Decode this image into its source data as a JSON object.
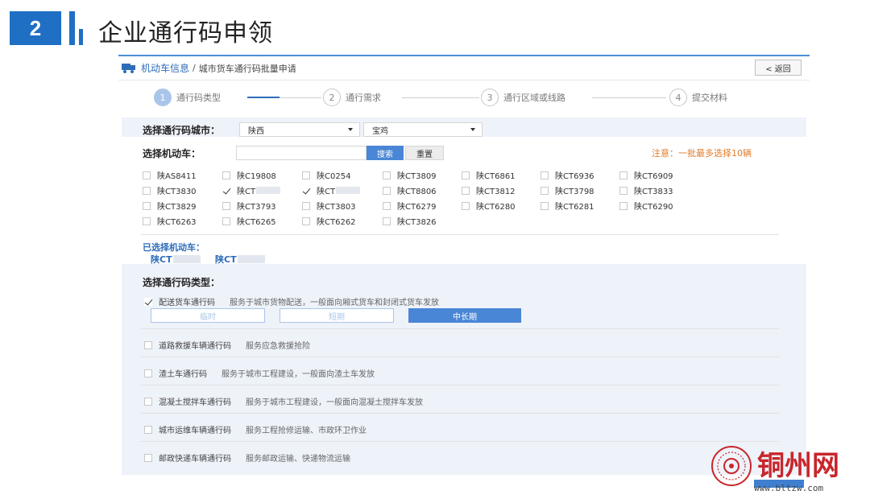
{
  "slide": {
    "number": "2",
    "title": "企业通行码申领"
  },
  "breadcrumb": {
    "root": "机动车信息",
    "separator": "/",
    "current": "城市货车通行码批量申请"
  },
  "back_button": "< 返回",
  "steps": [
    {
      "num": "1",
      "label": "通行码类型",
      "active": true
    },
    {
      "num": "2",
      "label": "通行需求",
      "active": false
    },
    {
      "num": "3",
      "label": "通行区域或线路",
      "active": false
    },
    {
      "num": "4",
      "label": "提交材料",
      "active": false
    }
  ],
  "city": {
    "label": "选择通行码城市：",
    "province": "陕西",
    "city": "宝鸡"
  },
  "vehicle": {
    "label": "选择机动车：",
    "search_value": "",
    "search_button": "搜索",
    "reset_button": "重置",
    "note": "注意：一批最多选择10辆"
  },
  "vehicles": [
    [
      "陕AS8411",
      "陕C19808",
      "陕C0254",
      "陕CT3809",
      "陕CT6861",
      "陕CT6936",
      "陕CT6909"
    ],
    [
      "陕CT3830",
      "陕CT",
      "陕CT",
      "陕CT8806",
      "陕CT3812",
      "陕CT3798",
      "陕CT3833"
    ],
    [
      "陕CT3829",
      "陕CT3793",
      "陕CT3803",
      "陕CT6279",
      "陕CT6280",
      "陕CT6281",
      "陕CT6290"
    ],
    [
      "陕CT6263",
      "陕CT6265",
      "陕CT6262",
      "陕CT3826"
    ]
  ],
  "selected": {
    "label": "已选择机动车：",
    "items": [
      "陕CT",
      "陕CT"
    ]
  },
  "pass_type": {
    "label": "选择通行码类型：",
    "options": [
      {
        "name": "配送货车通行码",
        "desc": "服务于城市货物配送，一般面向厢式货车和封闭式货车发放",
        "checked": true
      },
      {
        "name": "道路救援车辆通行码",
        "desc": "服务应急救援抢险",
        "checked": false
      },
      {
        "name": "渣土车通行码",
        "desc": "服务于城市工程建设，一般面向渣土车发放",
        "checked": false
      },
      {
        "name": "混凝土搅拌车通行码",
        "desc": "服务于城市工程建设，一般面向混凝土搅拌车发放",
        "checked": false
      },
      {
        "name": "城市运维车辆通行码",
        "desc": "服务工程抢修运输、市政环卫作业",
        "checked": false
      },
      {
        "name": "邮政快递车辆通行码",
        "desc": "服务邮政运输、快递物流运输",
        "checked": false
      }
    ],
    "durations": [
      "临时",
      "短期",
      "中长期"
    ],
    "active_duration": "中长期"
  },
  "watermark": {
    "name": "铜州网",
    "url": "www.bltzw.com"
  },
  "colors": {
    "primary": "#1f6fc4",
    "accent": "#4a86d6",
    "warning": "#e07b2a",
    "watermark_red": "#c8262c"
  }
}
